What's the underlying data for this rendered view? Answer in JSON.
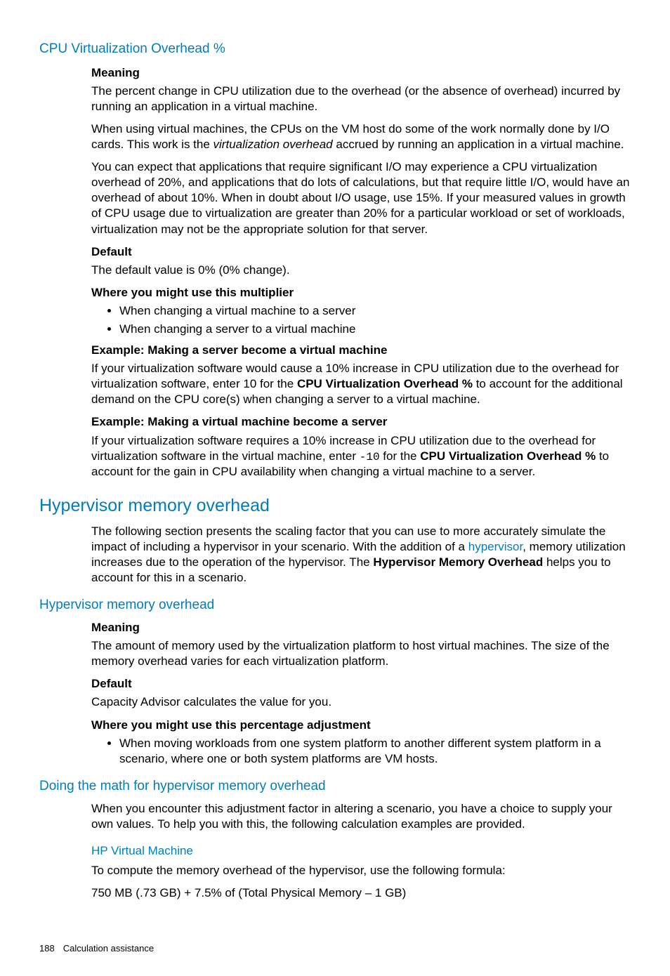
{
  "s1": {
    "title": "CPU Virtualization Overhead %",
    "meaning_label": "Meaning",
    "meaning_p1": "The percent change in CPU utilization due to the overhead (or the absence of overhead) incurred by running an application in a virtual machine.",
    "meaning_p2a": "When using virtual machines, the CPUs on the VM host do some of the work normally done by I/O cards. This work is the ",
    "meaning_p2_italic": "virtualization overhead",
    "meaning_p2b": " accrued by running an application in a virtual machine.",
    "meaning_p3": "You can expect that applications that require significant I/O may experience a CPU virtualization overhead of 20%, and applications that do lots of calculations, but that require little I/O, would have an overhead of about 10%. When in doubt about I/O usage, use 15%. If your measured values in growth of CPU usage due to virtualization are greater than 20% for a particular workload or set of workloads, virtualization may not be the appropriate solution for that server.",
    "default_label": "Default",
    "default_text": "The default value is 0% (0% change).",
    "where_label": "Where you might use this multiplier",
    "where_li1": "When changing a virtual machine to a server",
    "where_li2": "When changing a server to a virtual machine",
    "ex1_label": "Example: Making a server become a virtual machine",
    "ex1_a": "If your virtualization software would cause a 10% increase in CPU utilization due to the overhead for virtualization software, enter 10 for the ",
    "ex1_bold": "CPU Virtualization Overhead %",
    "ex1_b": " to account for the additional demand on the CPU core(s) when changing a server to a virtual machine.",
    "ex2_label": "Example: Making a virtual machine become a server",
    "ex2_a": "If your virtualization software requires a 10% increase in CPU utilization due to the overhead for virtualization software in the virtual machine, enter ",
    "ex2_mono": "-10",
    "ex2_b": " for the ",
    "ex2_bold": "CPU Virtualization Overhead %",
    "ex2_c": " to account for the gain in CPU availability when changing a virtual machine to a server."
  },
  "s2": {
    "title": "Hypervisor memory overhead",
    "intro_a": "The following section presents the scaling factor that you can use to more accurately simulate the impact of including a hypervisor in your scenario. With the addition of a ",
    "intro_link": "hypervisor",
    "intro_b": ", memory utilization increases due to the operation of the hypervisor. The ",
    "intro_bold": "Hypervisor Memory Overhead",
    "intro_c": " helps you to account for this in a scenario."
  },
  "s3": {
    "title": "Hypervisor memory overhead",
    "meaning_label": "Meaning",
    "meaning_text": "The amount of memory used by the virtualization platform to host virtual machines. The size of the memory overhead varies for each virtualization platform.",
    "default_label": "Default",
    "default_text": "Capacity Advisor calculates the value for you.",
    "where_label": "Where you might use this percentage adjustment",
    "where_li1": "When moving workloads from one system platform to another different system platform in a scenario, where one or both system platforms are VM hosts."
  },
  "s4": {
    "title": "Doing the math for hypervisor memory overhead",
    "intro": "When you encounter this adjustment factor in altering a scenario, you have a choice to supply your own values. To help you with this, the following calculation examples are provided.",
    "sub_title": "HP Virtual Machine",
    "sub_p1": "To compute the memory overhead of the hypervisor, use the following formula:",
    "sub_p2": "750 MB (.73 GB) + 7.5% of (Total Physical Memory – 1 GB)"
  },
  "footer": {
    "page": "188",
    "section": "Calculation assistance"
  }
}
